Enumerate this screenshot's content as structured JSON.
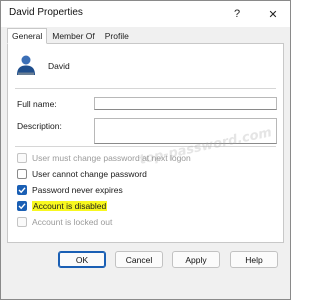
{
  "window": {
    "title": "David Properties",
    "help_glyph": "?",
    "close_glyph": "✕"
  },
  "tabs": [
    {
      "label": "General",
      "active": true
    },
    {
      "label": "Member Of",
      "active": false
    },
    {
      "label": "Profile",
      "active": false
    }
  ],
  "user": {
    "name": "David",
    "icon": "user-icon"
  },
  "fields": {
    "full_name_label": "Full name:",
    "full_name_value": "",
    "description_label": "Description:",
    "description_value": ""
  },
  "options": [
    {
      "label": "User must change password at next logon",
      "checked": false,
      "disabled": true,
      "highlighted": false
    },
    {
      "label": "User cannot change password",
      "checked": false,
      "disabled": false,
      "highlighted": false
    },
    {
      "label": "Password never expires",
      "checked": true,
      "disabled": false,
      "highlighted": false
    },
    {
      "label": "Account is disabled",
      "checked": true,
      "disabled": false,
      "highlighted": true
    },
    {
      "label": "Account is locked out",
      "checked": false,
      "disabled": true,
      "highlighted": false
    }
  ],
  "watermark": "top-password.com",
  "buttons": {
    "ok": "OK",
    "cancel": "Cancel",
    "apply": "Apply",
    "help": "Help"
  },
  "colors": {
    "accent": "#1a5fb4",
    "highlight": "#f8f81f"
  }
}
